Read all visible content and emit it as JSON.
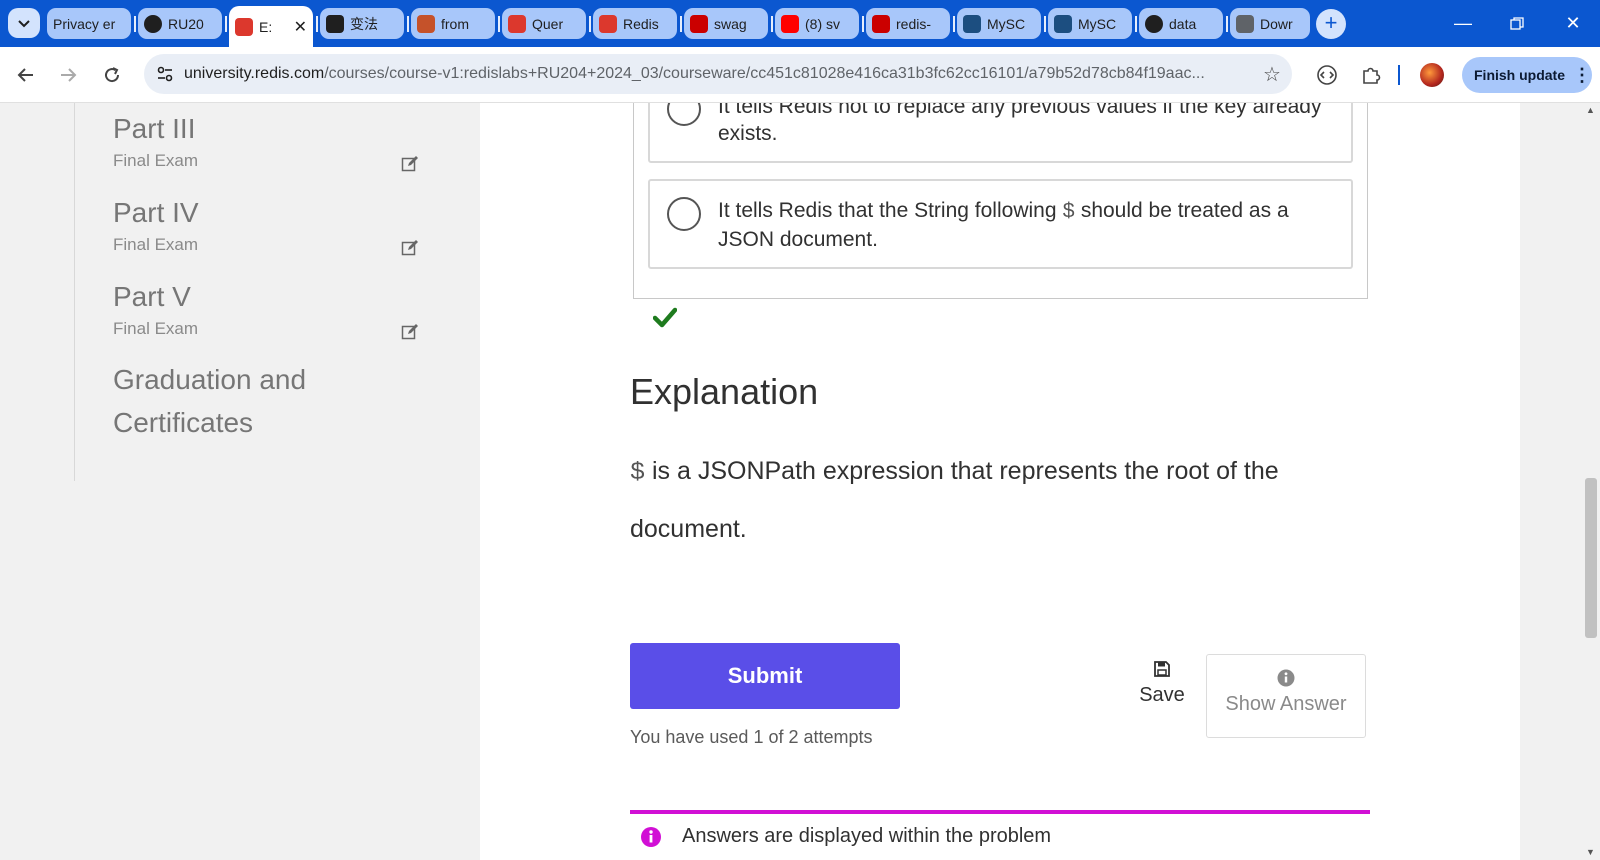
{
  "browser": {
    "tabs": [
      {
        "title": "Privacy er",
        "favicon": "privacy-icon",
        "color": "#5f6368"
      },
      {
        "title": "RU20",
        "favicon": "github-icon",
        "color": "#1f1f1f"
      },
      {
        "title": "E:",
        "favicon": "redis-cube-icon",
        "color": "#dc382d",
        "active": true
      },
      {
        "title": "变法",
        "favicon": "chat-icon",
        "color": "#1f1f1f"
      },
      {
        "title": "from",
        "favicon": "grid-icon",
        "color": "#c5522a"
      },
      {
        "title": "Quer",
        "favicon": "redis-cube-icon",
        "color": "#dc382d"
      },
      {
        "title": "Redis",
        "favicon": "redis-icon",
        "color": "#dc382d"
      },
      {
        "title": "swag",
        "favicon": "npm-icon",
        "color": "#cb0000"
      },
      {
        "title": "(8) sv",
        "favicon": "youtube-icon",
        "color": "#ff0000"
      },
      {
        "title": "redis-",
        "favicon": "npm-icon",
        "color": "#cb0000"
      },
      {
        "title": "MySC",
        "favicon": "mysql-icon",
        "color": "#1c4e80"
      },
      {
        "title": "MySC",
        "favicon": "mysql-icon",
        "color": "#1c4e80"
      },
      {
        "title": "data",
        "favicon": "github-icon",
        "color": "#1f1f1f"
      },
      {
        "title": "Dowr",
        "favicon": "download-icon",
        "color": "#5f6368"
      }
    ],
    "url_host": "university.redis.com",
    "url_path": "/courses/course-v1:redislabs+RU204+2024_03/courseware/cc451c81028e416ca31b3fc62cc16101/a79b52d78cb84f19aac...",
    "finish_update": "Finish update"
  },
  "sidebar": {
    "sections": [
      {
        "title": "Part III",
        "subtitle": "Final Exam"
      },
      {
        "title": "Part IV",
        "subtitle": "Final Exam"
      },
      {
        "title": "Part V",
        "subtitle": "Final Exam"
      }
    ],
    "graduation": "Graduation and Certificates"
  },
  "question": {
    "options": [
      {
        "text": "It tells Redis not to replace any previous values if the key already exists."
      },
      {
        "text_before": "It tells Redis that the String following",
        "symbol": "$",
        "text_after": "should be treated as a JSON document."
      }
    ]
  },
  "explanation": {
    "heading": "Explanation",
    "symbol": "$",
    "text": "is a JSONPath expression that represents the root of the document."
  },
  "actions": {
    "submit": "Submit",
    "attempts": "You have used 1 of 2 attempts",
    "save": "Save",
    "show_answer": "Show Answer"
  },
  "notice": "Answers are displayed within the problem",
  "colors": {
    "tabbar": "#0b57d0",
    "submit": "#5a4ee8",
    "notice_accent": "#d10fd5",
    "check": "#1e7b1e"
  }
}
